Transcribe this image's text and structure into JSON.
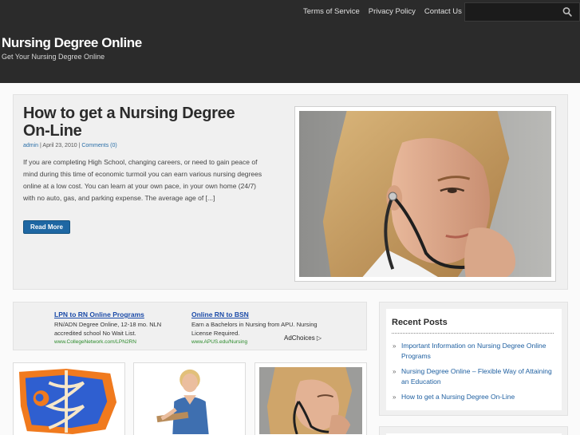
{
  "site": {
    "title": "Nursing Degree Online",
    "tagline": "Get Your Nursing Degree Online"
  },
  "top_nav": [
    {
      "label": "Terms of Service"
    },
    {
      "label": "Privacy Policy"
    },
    {
      "label": "Contact Us"
    }
  ],
  "search": {
    "placeholder": "",
    "value": ""
  },
  "featured": {
    "title": "How to get a Nursing Degree On-Line",
    "author": "admin",
    "date": "April 23, 2010",
    "comments": "Comments (0)",
    "separator": "|",
    "excerpt": "If you are completing High School, changing careers, or need to gain peace of mind during this time of economic turmoil you can earn various nursing degrees online at a low cost. You can learn at your own pace, in your own home (24/7) with no auto, gas, and parking expense. The average age of [...]",
    "read_more": "Read More"
  },
  "ads": [
    {
      "title": "LPN to RN Online Programs",
      "text": "RN/ADN Degree Online, 12-18 mo. NLN accredited school No Wait List.",
      "url": "www.CollegeNetwork.com/LPN2RN"
    },
    {
      "title": "Online RN to BSN",
      "text": "Earn a Bachelors in Nursing from APU. Nursing License Required.",
      "url": "www.APUS.edu/Nursing"
    }
  ],
  "adchoices": "AdChoices ▷",
  "sidebar": {
    "recent_title": "Recent Posts",
    "bullet": "»",
    "recent_posts": [
      {
        "label": "Important Information on Nursing Degree Online Programs"
      },
      {
        "label": "Nursing Degree Online – Flexible Way of Attaining an Education"
      },
      {
        "label": "How to get a Nursing Degree On-Line"
      }
    ]
  },
  "colors": {
    "header_bg": "#2b2b2b",
    "link": "#1e5fa0",
    "button": "#1e67a3"
  },
  "icons": {
    "search": "magnifier-icon"
  }
}
